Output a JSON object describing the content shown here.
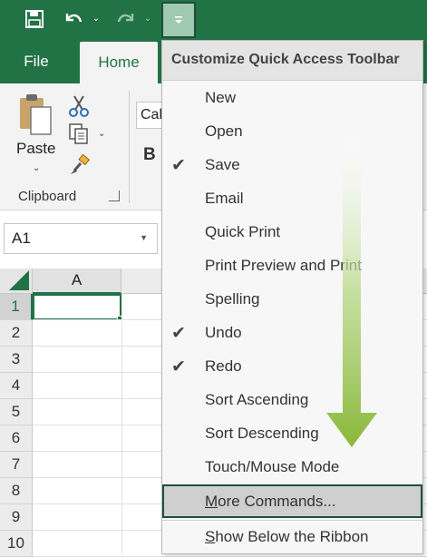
{
  "ribbon": {
    "tabs": {
      "file": "File",
      "home": "Home"
    },
    "paste_label": "Paste",
    "clipboard_label": "Clipboard",
    "font_box_value": "Cal",
    "bold_label": "B"
  },
  "namebox": {
    "value": "A1"
  },
  "grid": {
    "column_header": "A",
    "row_numbers": [
      "1",
      "2",
      "3",
      "4",
      "5",
      "6",
      "7",
      "8",
      "9",
      "10"
    ]
  },
  "menu": {
    "title": "Customize Quick Access Toolbar",
    "items": [
      {
        "label": "New",
        "checked": false
      },
      {
        "label": "Open",
        "checked": false
      },
      {
        "label": "Save",
        "checked": true
      },
      {
        "label": "Email",
        "checked": false
      },
      {
        "label": "Quick Print",
        "checked": false
      },
      {
        "label": "Print Preview and Print",
        "checked": false
      },
      {
        "label": "Spelling",
        "checked": false
      },
      {
        "label": "Undo",
        "checked": true
      },
      {
        "label": "Redo",
        "checked": true
      },
      {
        "label": "Sort Ascending",
        "checked": false
      },
      {
        "label": "Sort Descending",
        "checked": false
      },
      {
        "label": "Touch/Mouse Mode",
        "checked": false
      }
    ],
    "more_commands": {
      "underlined": "M",
      "rest": "ore Commands..."
    },
    "show_below": {
      "underlined": "S",
      "rest": "how Below the Ribbon"
    },
    "check_glyph": "✔"
  },
  "colors": {
    "excel_green": "#217346",
    "highlight_border": "#1f4e3d",
    "arrow_green": "#8ab83a"
  }
}
